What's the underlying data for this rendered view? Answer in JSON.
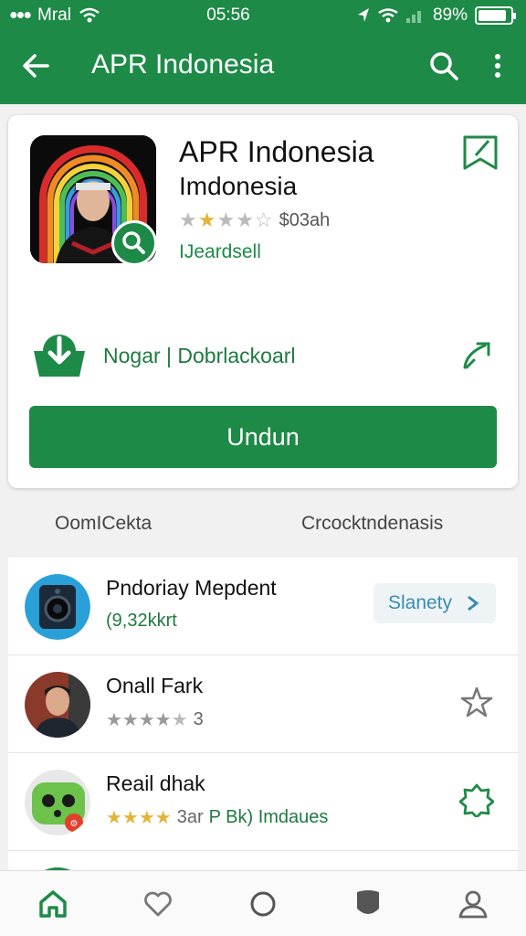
{
  "status": {
    "carrier": "Mral",
    "time": "05:56",
    "battery": "89%"
  },
  "header": {
    "title": "APR Indonesia"
  },
  "app": {
    "name": "APR Indonesia",
    "subtitle": "Imdonesia",
    "rating_stars": "★★★★☆",
    "rating_filled": 2,
    "rating_text": "$03ah",
    "developer": "IJeardsell",
    "download_text": "Nogar | Dobrlackoarl",
    "install_label": "Undun"
  },
  "sections": {
    "left": "OomICekta",
    "right": "Crcocktndenasis"
  },
  "list": [
    {
      "name": "Pndoriay Mepdent",
      "meta": "(9,32kkrt",
      "action_label": "Slanety"
    },
    {
      "name": "Onall Fark",
      "rating_count": "3",
      "rating_filled": 2
    },
    {
      "name": "Reail dhak",
      "rating_count": "3ar",
      "rating_filled": 4,
      "extra": "P Bk) Imdaues"
    }
  ],
  "colors": {
    "primary": "#1e8a47",
    "accent_blue": "#3a8bb0",
    "star": "#e2b53a"
  },
  "icons": {
    "app_bar": [
      "back-arrow-icon",
      "search-icon",
      "more-vert-icon"
    ],
    "bottom_nav": [
      "home-icon",
      "heart-icon",
      "circle-icon",
      "shield-icon",
      "profile-icon"
    ]
  }
}
